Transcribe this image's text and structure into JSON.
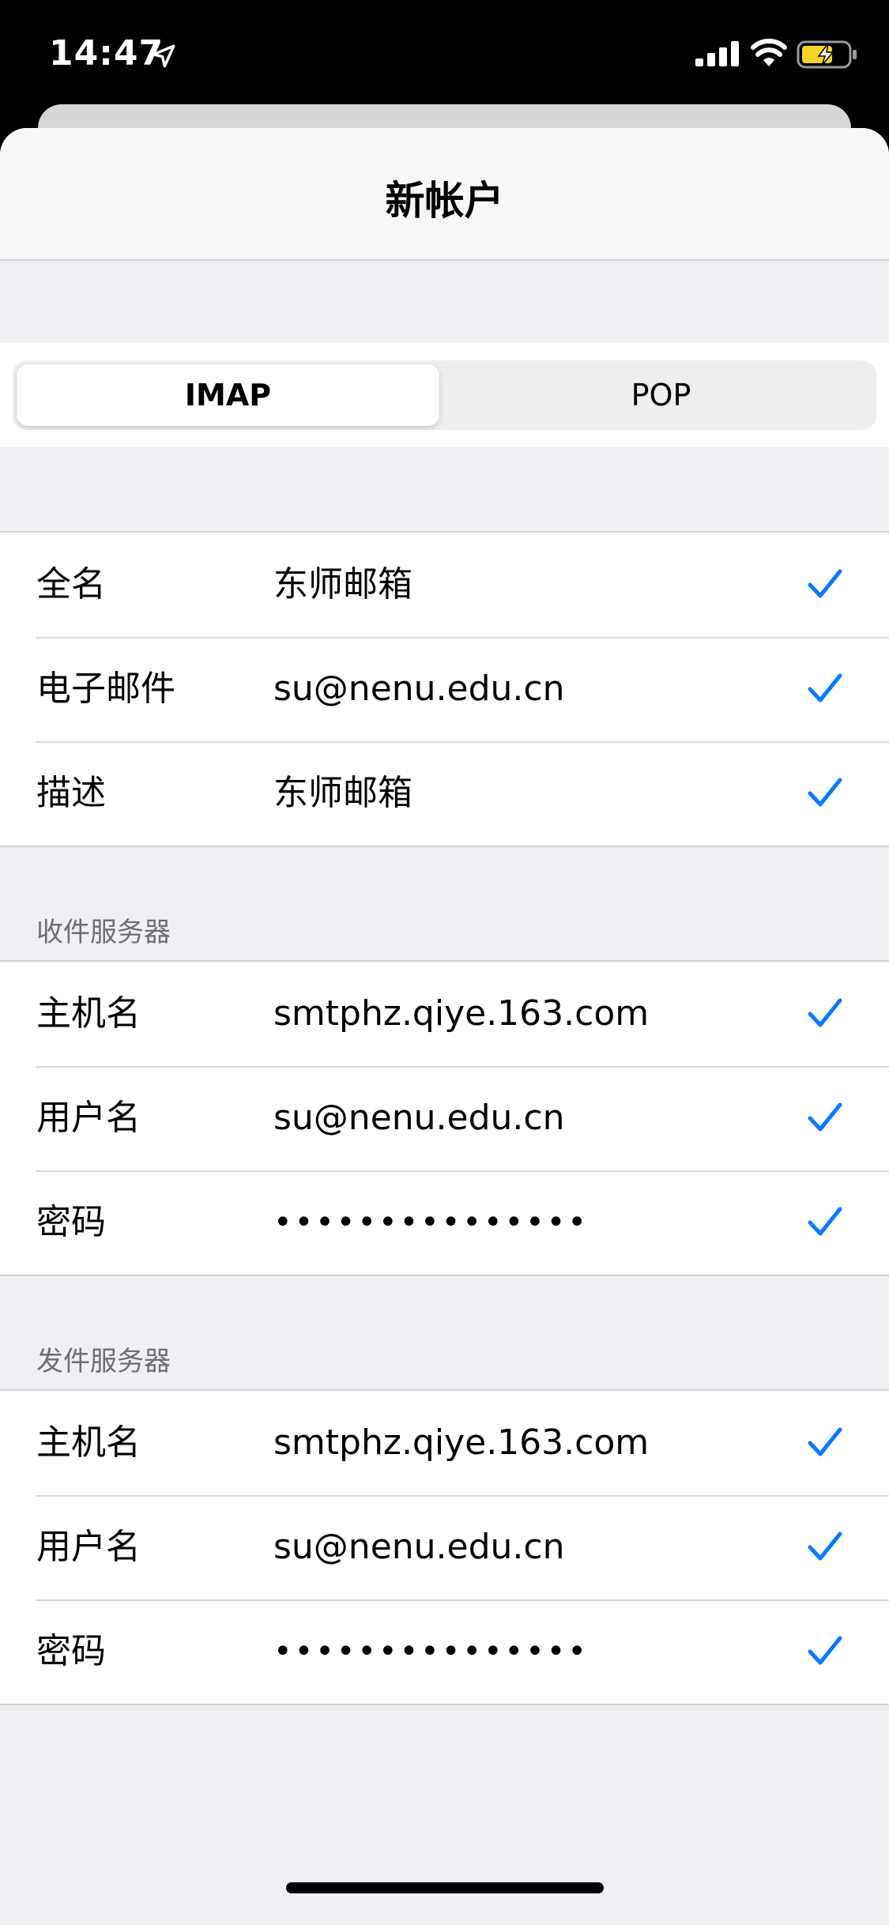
{
  "status_bar": {
    "time": "14:47",
    "icons": [
      "location-arrow-icon",
      "cellular-signal-icon",
      "wifi-icon",
      "battery-charging-icon"
    ]
  },
  "nav": {
    "title": "新帐户"
  },
  "segmented": {
    "options": [
      {
        "label": "IMAP",
        "selected": true
      },
      {
        "label": "POP",
        "selected": false
      }
    ]
  },
  "account": {
    "rows": [
      {
        "label": "全名",
        "value": "东师邮箱",
        "valid": true
      },
      {
        "label": "电子邮件",
        "value": "su@nenu.edu.cn",
        "valid": true
      },
      {
        "label": "描述",
        "value": "东师邮箱",
        "valid": true
      }
    ]
  },
  "incoming": {
    "header": "收件服务器",
    "rows": [
      {
        "label": "主机名",
        "value": "smtphz.qiye.163.com",
        "valid": true
      },
      {
        "label": "用户名",
        "value": "su@nenu.edu.cn",
        "valid": true
      },
      {
        "label": "密码",
        "value": "•••••••••••••••",
        "valid": true
      }
    ]
  },
  "outgoing": {
    "header": "发件服务器",
    "rows": [
      {
        "label": "主机名",
        "value": "smtphz.qiye.163.com",
        "valid": true
      },
      {
        "label": "用户名",
        "value": "su@nenu.edu.cn",
        "valid": true
      },
      {
        "label": "密码",
        "value": "•••••••••••••••",
        "valid": true
      }
    ]
  },
  "colors": {
    "accent": "#0a7aff",
    "background": "#efeff4",
    "section_header": "#6d6d72"
  }
}
